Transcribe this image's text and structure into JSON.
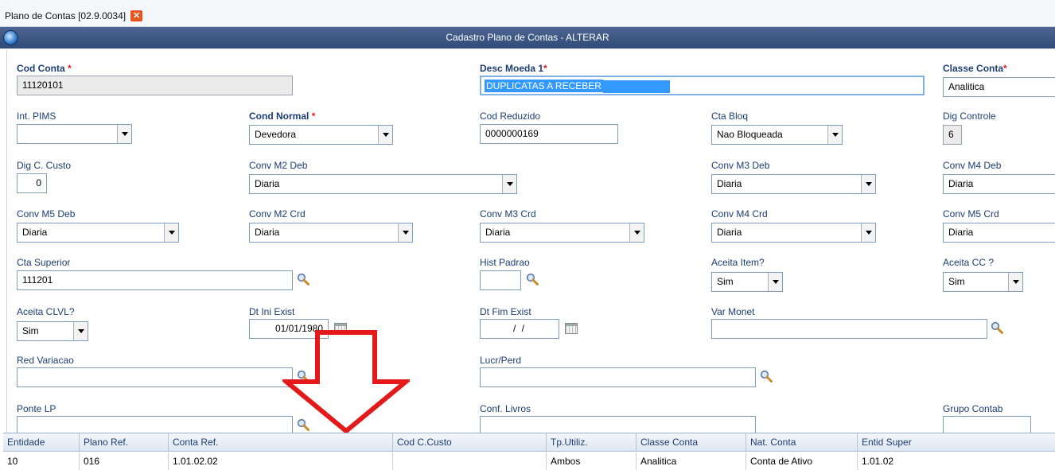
{
  "tab": {
    "label": "Plano de Contas [02.9.0034]",
    "close_glyph": "✕"
  },
  "window": {
    "title": "Cadastro Plano de Contas - ALTERAR"
  },
  "fields": {
    "cod_conta": {
      "label": "Cod Conta",
      "value": "11120101"
    },
    "desc_moeda1": {
      "label": "Desc Moeda 1",
      "value": "DUPLICATAS A RECEBER"
    },
    "classe_conta": {
      "label": "Classe Conta",
      "value": "Analitica"
    },
    "int_pims": {
      "label": "Int. PIMS",
      "value": ""
    },
    "cond_normal": {
      "label": "Cond Normal",
      "value": "Devedora"
    },
    "cod_reduzido": {
      "label": "Cod Reduzido",
      "value": "0000000169"
    },
    "cta_bloq": {
      "label": "Cta Bloq",
      "value": "Nao Bloqueada"
    },
    "dig_controle": {
      "label": "Dig Controle",
      "value": "6"
    },
    "dig_c_custo": {
      "label": "Dig C. Custo",
      "value": "0"
    },
    "conv_m2_deb": {
      "label": "Conv M2 Deb",
      "value": "Diaria"
    },
    "conv_m3_deb": {
      "label": "Conv M3 Deb",
      "value": "Diaria"
    },
    "conv_m4_deb": {
      "label": "Conv M4 Deb",
      "value": "Diaria"
    },
    "conv_m5_deb": {
      "label": "Conv M5 Deb",
      "value": "Diaria"
    },
    "conv_m2_crd": {
      "label": "Conv M2 Crd",
      "value": "Diaria"
    },
    "conv_m3_crd": {
      "label": "Conv M3 Crd",
      "value": "Diaria"
    },
    "conv_m4_crd": {
      "label": "Conv M4 Crd",
      "value": "Diaria"
    },
    "conv_m5_crd": {
      "label": "Conv M5 Crd",
      "value": "Diaria"
    },
    "cta_superior": {
      "label": "Cta Superior",
      "value": "111201"
    },
    "hist_padrao": {
      "label": "Hist Padrao",
      "value": ""
    },
    "aceita_item": {
      "label": "Aceita Item?",
      "value": "Sim"
    },
    "aceita_cc": {
      "label": "Aceita CC ?",
      "value": "Sim"
    },
    "aceita_clvl": {
      "label": "Aceita CLVL?",
      "value": "Sim"
    },
    "dt_ini_exist": {
      "label": "Dt Ini Exist",
      "value": "01/01/1980"
    },
    "dt_fim_exist": {
      "label": "Dt Fim Exist",
      "value": "/ /"
    },
    "var_monet": {
      "label": "Var Monet",
      "value": ""
    },
    "red_variacao": {
      "label": "Red Variacao",
      "value": ""
    },
    "lucr_perd": {
      "label": "Lucr/Perd",
      "value": ""
    },
    "ponte_lp": {
      "label": "Ponte LP",
      "value": ""
    },
    "conf_livros": {
      "label": "Conf. Livros",
      "value": ""
    },
    "grupo_contab": {
      "label": "Grupo Contab",
      "value": ""
    }
  },
  "required_marker": "*",
  "grid": {
    "columns": [
      "Entidade",
      "Plano Ref.",
      "Conta Ref.",
      "Cod C.Custo",
      "Tp.Utiliz.",
      "Classe Conta",
      "Nat. Conta",
      "Entid Super"
    ],
    "rows": [
      [
        "10",
        "016",
        "1.01.02.02",
        "",
        "Ambos",
        "Analitica",
        "Conta de Ativo",
        "1.01.02"
      ]
    ]
  },
  "colors": {
    "titlebar": "#2f4b79",
    "label": "#1c3d73",
    "required": "#e02020",
    "arrow": "#e3191a"
  }
}
